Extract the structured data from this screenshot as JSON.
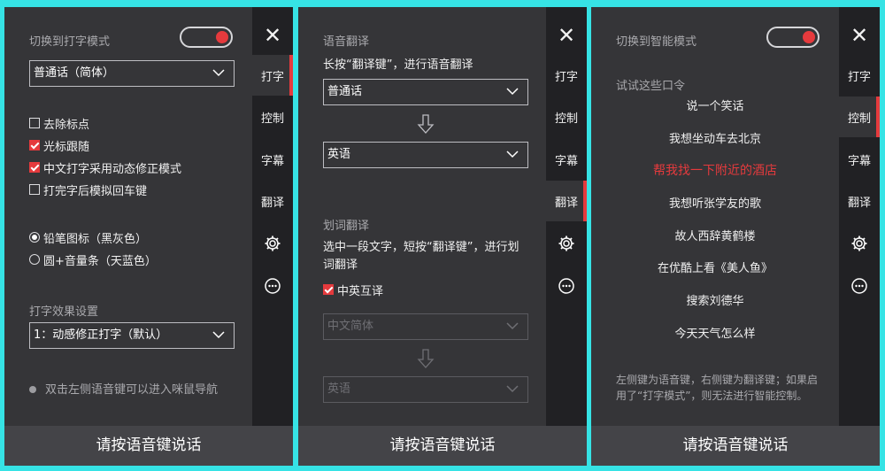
{
  "footer_label": "请按语音键说话",
  "sidebar": {
    "close": "✕",
    "tabs": [
      "打字",
      "控制",
      "字幕",
      "翻译"
    ]
  },
  "colors": {
    "accent": "#e53a3d",
    "panel": "#353538",
    "sidebar": "#212124",
    "background": "#36e3e5"
  },
  "panel1": {
    "mode_switch_label": "切换到打字模式",
    "language_select": "普通话（简体）",
    "options": [
      {
        "label": "去除标点",
        "checked": false
      },
      {
        "label": "光标跟随",
        "checked": true
      },
      {
        "label": "中文打字采用动态修正模式",
        "checked": true
      },
      {
        "label": "打完字后模拟回车键",
        "checked": false
      }
    ],
    "radios": [
      {
        "label": "铅笔图标（黑灰色）",
        "checked": true
      },
      {
        "label": "圆+音量条（天蓝色）",
        "checked": false
      }
    ],
    "effect_label": "打字效果设置",
    "effect_select": "1：动感修正打字（默认）",
    "tip": "双击左侧语音键可以进入咪鼠导航"
  },
  "panel2": {
    "voice_title": "语音翻译",
    "voice_desc": "长按“翻译键”，进行语音翻译",
    "source_lang": "普通话",
    "target_lang": "英语",
    "word_title": "划词翻译",
    "word_desc": "选中一段文字，短按“翻译键”，进行划词翻译",
    "cn_en_label": "中英互译",
    "cn_en_checked": true,
    "word_source": "中文简体",
    "word_target": "英语"
  },
  "panel3": {
    "mode_switch_label": "切换到智能模式",
    "try_label": "试试这些口令",
    "commands": [
      "说一个笑话",
      "我想坐动车去北京",
      "帮我找一下附近的酒店",
      "我想听张学友的歌",
      "故人西辞黄鹤楼",
      "在优酷上看《美人鱼》",
      "搜索刘德华",
      "今天天气怎么样"
    ],
    "highlight_index": 2,
    "note": "左侧键为语音键，右侧键为翻译键；如果启用了“打字模式”，则无法进行智能控制。"
  }
}
